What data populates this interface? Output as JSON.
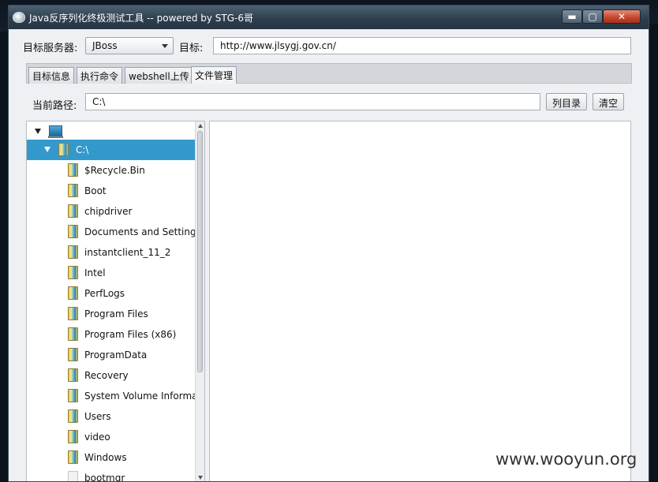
{
  "window": {
    "title": "Java反序列化终极测试工具  -- powered by STG-6哥",
    "controls": {
      "minimize": "▬",
      "maximize": "▢",
      "close": "✕"
    }
  },
  "form": {
    "server_label": "目标服务器:",
    "server_value": "JBoss",
    "target_label": "目标:",
    "target_value": "http://www.jlsygj.gov.cn/"
  },
  "tabs": [
    "目标信息",
    "执行命令",
    "webshell上传",
    "文件管理"
  ],
  "active_tab": "文件管理",
  "path": {
    "label": "当前路径:",
    "value": "C:\\",
    "list_button": "列目录",
    "clear_button": "清空"
  },
  "tree": {
    "root_icon": "computer-icon",
    "selected": "C:\\",
    "items": [
      "$Recycle.Bin",
      "Boot",
      "chipdriver",
      "Documents and Settings",
      "instantclient_11_2",
      "Intel",
      "PerfLogs",
      "Program Files",
      "Program Files (x86)",
      "ProgramData",
      "Recovery",
      "System Volume Information",
      "Users",
      "video",
      "Windows",
      "bootmgr"
    ]
  },
  "watermark": "www.wooyun.org"
}
